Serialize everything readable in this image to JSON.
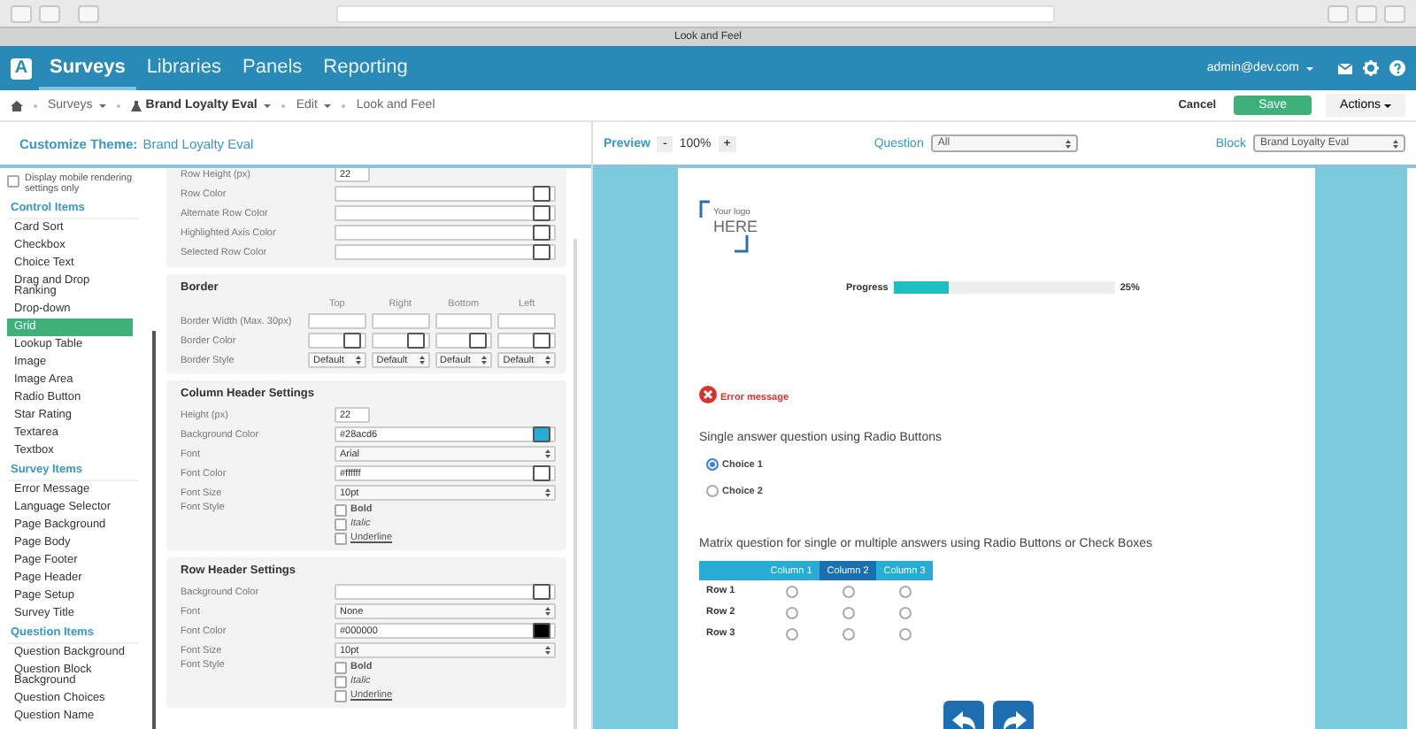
{
  "browser": {
    "tab_title": "Look and Feel"
  },
  "nav": {
    "logo": "A",
    "items": [
      {
        "label": "Surveys",
        "selected": true
      },
      {
        "label": "Libraries",
        "selected": false
      },
      {
        "label": "Panels",
        "selected": false
      },
      {
        "label": "Reporting",
        "selected": false
      }
    ],
    "user": "admin@dev.com"
  },
  "breadcrumb": [
    {
      "label": "Surveys",
      "kind": "dropdown"
    },
    {
      "label": "Brand Loyalty Eval",
      "kind": "survey"
    },
    {
      "label": "Edit",
      "kind": "dropdown"
    },
    {
      "label": "Look and Feel",
      "kind": "plain"
    }
  ],
  "actions": {
    "cancel": "Cancel",
    "save": "Save",
    "more": "Actions"
  },
  "theme_header": {
    "label": "Customize Theme:",
    "name": "Brand Loyalty Eval"
  },
  "mobile_only": {
    "label": "Display mobile rendering settings only",
    "checked": false
  },
  "sidebar": [
    {
      "title": "Control Items",
      "items": [
        {
          "label": "Card Sort",
          "selected": false
        },
        {
          "label": "Checkbox",
          "selected": false
        },
        {
          "label": "Choice Text",
          "selected": false
        },
        {
          "label": "Drag and Drop Ranking",
          "selected": false
        },
        {
          "label": "Drop-down",
          "selected": false
        },
        {
          "label": "Grid",
          "selected": true
        },
        {
          "label": "Lookup Table",
          "selected": false
        },
        {
          "label": "Image",
          "selected": false
        },
        {
          "label": "Image Area",
          "selected": false
        },
        {
          "label": "Radio Button",
          "selected": false
        },
        {
          "label": "Star Rating",
          "selected": false
        },
        {
          "label": "Textarea",
          "selected": false
        },
        {
          "label": "Textbox",
          "selected": false
        }
      ]
    },
    {
      "title": "Survey Items",
      "items": [
        {
          "label": "Error Message",
          "selected": false
        },
        {
          "label": "Language Selector",
          "selected": false
        },
        {
          "label": "Page Background",
          "selected": false
        },
        {
          "label": "Page Body",
          "selected": false
        },
        {
          "label": "Page Footer",
          "selected": false
        },
        {
          "label": "Page Header",
          "selected": false
        },
        {
          "label": "Page Setup",
          "selected": false
        },
        {
          "label": "Survey Title",
          "selected": false
        }
      ]
    },
    {
      "title": "Question Items",
      "items": [
        {
          "label": "Question Background",
          "selected": false
        },
        {
          "label": "Question Block Background",
          "selected": false
        },
        {
          "label": "Question Choices",
          "selected": false
        },
        {
          "label": "Question Name",
          "selected": false
        }
      ]
    }
  ],
  "grid_settings": [
    {
      "label": "Row Height (px)",
      "kind": "number",
      "value": "22"
    },
    {
      "label": "Row Color",
      "kind": "color"
    },
    {
      "label": "Alternate Row Color",
      "kind": "color"
    },
    {
      "label": "Highlighted Axis Color",
      "kind": "color"
    },
    {
      "label": "Selected Row Color",
      "kind": "color"
    }
  ],
  "border": {
    "title": "Border",
    "columns": [
      "Top",
      "Right",
      "Bottom",
      "Left"
    ],
    "rows": [
      {
        "label": "Border Width (Max. 30px)",
        "kind": "text"
      },
      {
        "label": "Border Color",
        "kind": "color"
      },
      {
        "label": "Border Style",
        "kind": "select",
        "values": [
          "Default",
          "Default",
          "Default",
          "Default"
        ]
      }
    ]
  },
  "header_sections": [
    {
      "title": "Column Header Settings",
      "fields": [
        {
          "label": "Height (px)",
          "kind": "number",
          "value": "22"
        },
        {
          "label": "Background Color",
          "kind": "color",
          "value": "#28acd6",
          "color": "#28acd6"
        },
        {
          "label": "Font",
          "kind": "select",
          "value": "Arial"
        },
        {
          "label": "Font Color",
          "kind": "color",
          "value": "#ffffff",
          "color": "#ffffff"
        },
        {
          "label": "Font Size",
          "kind": "select",
          "value": "10pt"
        },
        {
          "label": "Font Style",
          "kind": "checks",
          "options": [
            {
              "label": "Bold",
              "checked": false
            },
            {
              "label": "Italic",
              "checked": false
            },
            {
              "label": "Underline",
              "checked": false
            }
          ]
        }
      ]
    },
    {
      "title": "Row Header Settings",
      "fields": [
        {
          "label": "Background Color",
          "kind": "color"
        },
        {
          "label": "Font",
          "kind": "select",
          "value": "None"
        },
        {
          "label": "Font Color",
          "kind": "color",
          "value": "#000000",
          "color": "#000000"
        },
        {
          "label": "Font Size",
          "kind": "select",
          "value": "10pt"
        },
        {
          "label": "Font Style",
          "kind": "checks",
          "options": [
            {
              "label": "Bold",
              "checked": false
            },
            {
              "label": "Italic",
              "checked": false
            },
            {
              "label": "Underline",
              "checked": false
            }
          ]
        }
      ]
    }
  ],
  "preview_bar": {
    "title": "Preview",
    "zoom_out": "-",
    "zoom": "100%",
    "zoom_in": "+",
    "question_label": "Question",
    "question_value": "All",
    "block_label": "Block",
    "block_value": "Brand Loyalty Eval"
  },
  "preview": {
    "logo_small": "Your logo",
    "logo_big": "HERE",
    "progress_label": "Progress",
    "level": 0.25,
    "progress_text": "25%",
    "error": "Error message",
    "question1": "Single answer question using Radio Buttons",
    "choices": [
      {
        "label": "Choice 1",
        "selected": true
      },
      {
        "label": "Choice 2",
        "selected": false
      }
    ],
    "question2": "Matrix question for single or multiple answers using Radio Buttons or Check Boxes",
    "matrix_columns": [
      {
        "label": "Column 1",
        "highlighted": false
      },
      {
        "label": "Column 2",
        "highlighted": true
      },
      {
        "label": "Column 3",
        "highlighted": false
      }
    ],
    "matrix_rows": [
      {
        "label": "Row 1",
        "cells": [
          {
            "selected": false
          },
          {
            "selected": false
          },
          {
            "selected": false
          }
        ]
      },
      {
        "label": "Row 2",
        "cells": [
          {
            "selected": false
          },
          {
            "selected": false
          },
          {
            "selected": false
          }
        ]
      },
      {
        "label": "Row 3",
        "cells": [
          {
            "selected": false
          },
          {
            "selected": false
          },
          {
            "selected": false
          }
        ]
      }
    ]
  }
}
